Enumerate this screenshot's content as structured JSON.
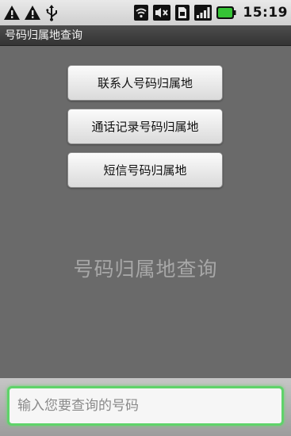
{
  "status_bar": {
    "icons": [
      "warning-icon",
      "warning-icon",
      "usb-icon",
      "wifi-icon",
      "volume-muted-icon",
      "sim-icon",
      "signal-icon",
      "battery-icon"
    ],
    "time": "15:19"
  },
  "app": {
    "title": "号码归属地查询"
  },
  "buttons": {
    "contacts": "联系人号码归属地",
    "call_log": "通话记录号码归属地",
    "sms": "短信号码归属地"
  },
  "hero_text": "号码归属地查询",
  "input": {
    "value": "",
    "placeholder": "输入您要查询的号码"
  },
  "colors": {
    "focus_border": "#5fd36a",
    "battery": "#36c436"
  }
}
